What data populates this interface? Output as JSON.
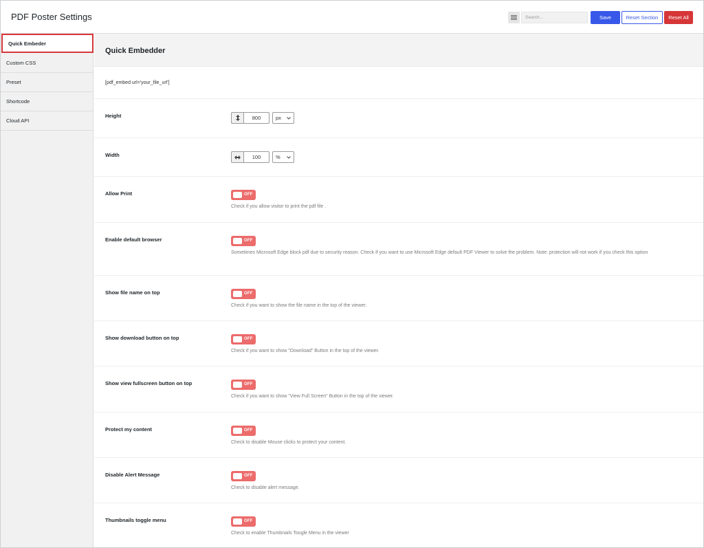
{
  "header": {
    "title": "PDF Poster Settings",
    "search_placeholder": "Search...",
    "save_label": "Save",
    "reset_section_label": "Reset Section",
    "reset_all_label": "Reset All"
  },
  "sidebar": {
    "items": [
      {
        "label": "Quick Embeder",
        "active": true
      },
      {
        "label": "Custom CSS"
      },
      {
        "label": "Preset"
      },
      {
        "label": "Shortcode"
      },
      {
        "label": "Cloud API"
      }
    ]
  },
  "main": {
    "section_title": "Quick Embedder",
    "shortcode": "[pdf_embed url='your_file_url']",
    "height": {
      "label": "Height",
      "value": "800",
      "unit": "px"
    },
    "width": {
      "label": "Width",
      "value": "100",
      "unit": "%"
    },
    "options": [
      {
        "label": "Allow Print",
        "state": "OFF",
        "desc": "Check if you allow visitor to print the pdf file ."
      },
      {
        "label": "Enable default browser",
        "state": "OFF",
        "desc": "Sometimes Microsoft Edge block pdf due to security reason. Check if you want to use Microsoft Edge default PDF Viewer to solve the problem. Note: protection will not work if you check this option"
      },
      {
        "label": "Show file name on top",
        "state": "OFF",
        "desc": "Check if you want to show the file name in the top of the viewer."
      },
      {
        "label": "Show download button on top",
        "state": "OFF",
        "desc": "Check if you want to show \"Download\" Button in the top of the viewer."
      },
      {
        "label": "Show view fullscreen button on top",
        "state": "OFF",
        "desc": "Check if you want to show \"View Full Screen\" Button in the top of the viewer."
      },
      {
        "label": "Protect my content",
        "state": "OFF",
        "desc": "Check to disable Mouse clicks to protect your content."
      },
      {
        "label": "Disable Alert Message",
        "state": "OFF",
        "desc": "Check to disable alert message."
      },
      {
        "label": "Thumbnails toggle menu",
        "state": "OFF",
        "desc": "Check to enable Thumbnails Toogle Menu in the viewer"
      }
    ]
  },
  "colors": {
    "primary": "#3858e9",
    "danger": "#d63638",
    "toggle_off": "#ec6b6b"
  }
}
